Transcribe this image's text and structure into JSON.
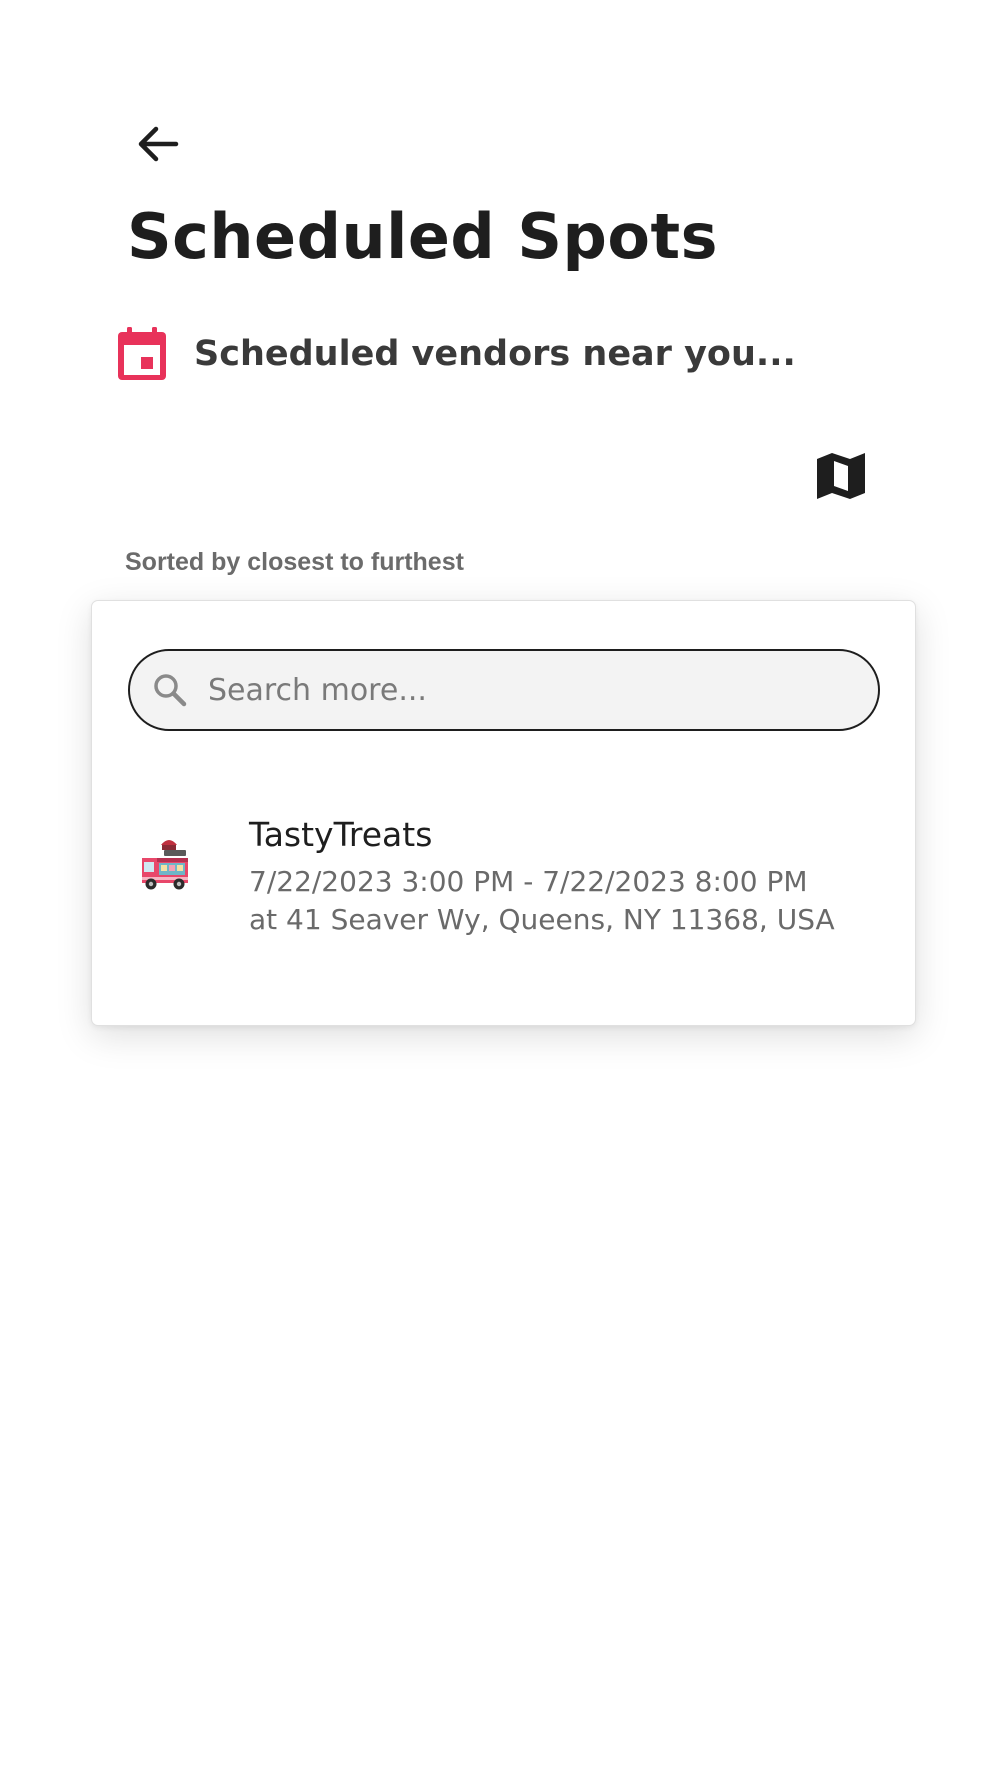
{
  "header": {
    "title": "Scheduled Spots",
    "back_icon": "arrow-left-icon"
  },
  "section": {
    "icon": "calendar-icon",
    "title": "Scheduled vendors near you..."
  },
  "map_toggle": {
    "icon": "map-icon"
  },
  "sort_label": "Sorted by closest to furthest",
  "search": {
    "placeholder": "Search more...",
    "value": "",
    "icon": "search-icon"
  },
  "vendors": [
    {
      "icon": "food-truck-icon",
      "name": "TastyTreats",
      "details": "7/22/2023 3:00 PM - 7/22/2023 8:00 PM at 41 Seaver Wy, Queens, NY 11368, USA"
    }
  ],
  "colors": {
    "accent": "#e8325a",
    "text_primary": "#1e1e1e",
    "text_secondary": "#6a6a6a"
  }
}
